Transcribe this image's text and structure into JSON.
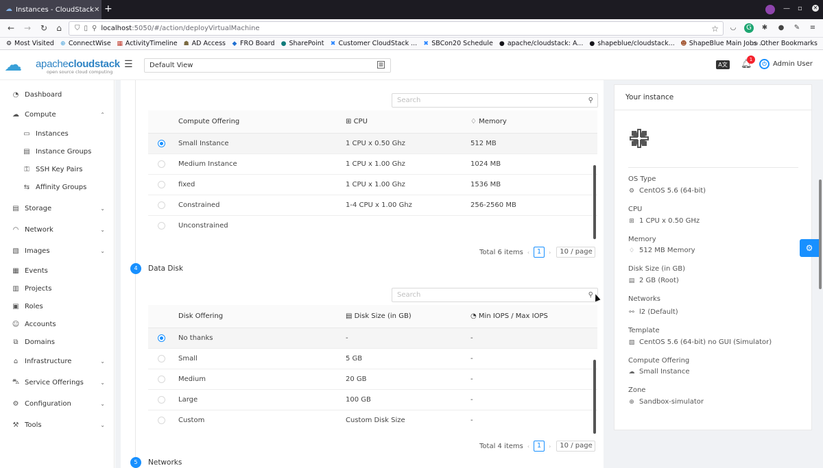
{
  "browser": {
    "tab_title": "Instances - CloudStack",
    "url_host": "localhost",
    "url_path": ":5050/#/action/deployVirtualMachine",
    "bookmarks": [
      {
        "label": "Most Visited",
        "icon": "gear-icon"
      },
      {
        "label": "ConnectWise",
        "icon": "globe-icon"
      },
      {
        "label": "ActivityTimeline",
        "icon": "timeline-icon"
      },
      {
        "label": "AD Access",
        "icon": "user-icon"
      },
      {
        "label": "FRO Board",
        "icon": "diamond-icon"
      },
      {
        "label": "SharePoint",
        "icon": "sharepoint-icon"
      },
      {
        "label": "Customer CloudStack ...",
        "icon": "jira-icon"
      },
      {
        "label": "SBCon20 Schedule",
        "icon": "jira-icon"
      },
      {
        "label": "apache/cloudstack: A...",
        "icon": "github-icon"
      },
      {
        "label": "shapeblue/cloudstack...",
        "icon": "github-icon"
      },
      {
        "label": "ShapeBlue Main Jobs ...",
        "icon": "person-icon"
      }
    ],
    "other_bookmarks": "Other Bookmarks"
  },
  "header": {
    "logo_text_light": "apache",
    "logo_text_bold": "cloudstack",
    "logo_sub": "open source cloud computing",
    "view_select": "Default View",
    "translate_label": "A文",
    "notification_count": "1",
    "user_name": "Admin User"
  },
  "sidebar": {
    "items": [
      {
        "label": "Dashboard",
        "icon": "dashboard-icon",
        "arrow": ""
      },
      {
        "label": "Compute",
        "icon": "cloud-icon",
        "arrow": "⌃"
      },
      {
        "label": "Instances",
        "icon": "desktop-icon",
        "arrow": ""
      },
      {
        "label": "Instance Groups",
        "icon": "gold-icon",
        "arrow": ""
      },
      {
        "label": "SSH Key Pairs",
        "icon": "key-icon",
        "arrow": ""
      },
      {
        "label": "Affinity Groups",
        "icon": "swap-icon",
        "arrow": ""
      },
      {
        "label": "Storage",
        "icon": "database-icon",
        "arrow": "⌄"
      },
      {
        "label": "Network",
        "icon": "wifi-icon",
        "arrow": "⌄"
      },
      {
        "label": "Images",
        "icon": "picture-icon",
        "arrow": "⌄"
      },
      {
        "label": "Events",
        "icon": "schedule-icon",
        "arrow": ""
      },
      {
        "label": "Projects",
        "icon": "project-icon",
        "arrow": ""
      },
      {
        "label": "Roles",
        "icon": "idcard-icon",
        "arrow": ""
      },
      {
        "label": "Accounts",
        "icon": "team-icon",
        "arrow": ""
      },
      {
        "label": "Domains",
        "icon": "block-icon",
        "arrow": ""
      },
      {
        "label": "Infrastructure",
        "icon": "bank-icon",
        "arrow": "⌄"
      },
      {
        "label": "Service Offerings",
        "icon": "shopping-icon",
        "arrow": "⌄"
      },
      {
        "label": "Configuration",
        "icon": "setting-icon",
        "arrow": "⌄"
      },
      {
        "label": "Tools",
        "icon": "tool-icon",
        "arrow": "⌄"
      }
    ]
  },
  "compute": {
    "search_placeholder": "Search",
    "headers": {
      "name": "Compute Offering",
      "cpu": "CPU",
      "memory": "Memory"
    },
    "rows": [
      {
        "name": "Small Instance",
        "cpu": "1 CPU x 0.50 Ghz",
        "memory": "512 MB",
        "selected": true
      },
      {
        "name": "Medium Instance",
        "cpu": "1 CPU x 1.00 Ghz",
        "memory": "1024 MB",
        "selected": false
      },
      {
        "name": "fixed",
        "cpu": "1 CPU x 1.00 Ghz",
        "memory": "1536 MB",
        "selected": false
      },
      {
        "name": "Constrained",
        "cpu": "1-4 CPU x 1.00 Ghz",
        "memory": "256-2560 MB",
        "selected": false
      },
      {
        "name": "Unconstrained",
        "cpu": "",
        "memory": "",
        "selected": false
      }
    ],
    "total": "Total 6 items",
    "page": "1",
    "page_size": "10 / page"
  },
  "data_disk": {
    "step": "4",
    "title": "Data Disk",
    "search_placeholder": "Search",
    "headers": {
      "name": "Disk Offering",
      "size": "Disk Size (in GB)",
      "iops": "Min IOPS / Max IOPS"
    },
    "rows": [
      {
        "name": "No thanks",
        "size": "-",
        "iops": "-",
        "selected": true
      },
      {
        "name": "Small",
        "size": "5 GB",
        "iops": "-",
        "selected": false
      },
      {
        "name": "Medium",
        "size": "20 GB",
        "iops": "-",
        "selected": false
      },
      {
        "name": "Large",
        "size": "100 GB",
        "iops": "-",
        "selected": false
      },
      {
        "name": "Custom",
        "size": "Custom Disk Size",
        "iops": "-",
        "selected": false
      }
    ],
    "total": "Total 4 items",
    "page": "1",
    "page_size": "10 / page"
  },
  "networks_step": {
    "step": "5",
    "title": "Networks"
  },
  "summary": {
    "title": "Your instance",
    "fields": [
      {
        "label": "OS Type",
        "value": "CentOS 5.6 (64-bit)",
        "icon": "gear-icon"
      },
      {
        "label": "CPU",
        "value": "1 CPU x 0.50 GHz",
        "icon": "appstore-icon"
      },
      {
        "label": "Memory",
        "value": "512 MB Memory",
        "icon": "bulb-icon"
      },
      {
        "label": "Disk Size (in GB)",
        "value": "2 GB (Root)",
        "icon": "hdd-icon"
      },
      {
        "label": "Networks",
        "value": "l2 (Default)",
        "icon": "link-icon"
      },
      {
        "label": "Template",
        "value": "CentOS 5.6 (64-bit) no GUI (Simulator)",
        "icon": "picture-icon"
      },
      {
        "label": "Compute Offering",
        "value": "Small Instance",
        "icon": "cloud-icon"
      },
      {
        "label": "Zone",
        "value": "Sandbox-simulator",
        "icon": "global-icon"
      }
    ]
  }
}
